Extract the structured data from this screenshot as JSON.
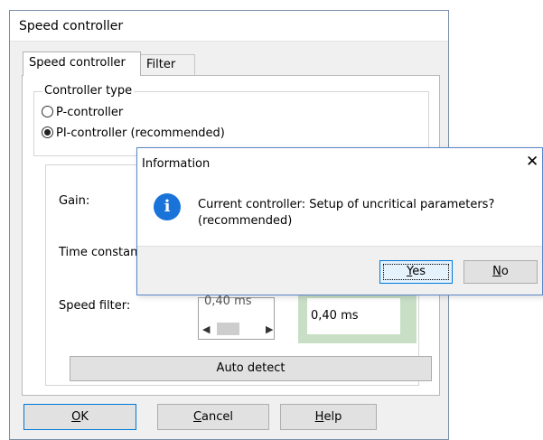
{
  "window": {
    "title": "Speed controller"
  },
  "tabs": [
    {
      "label": "Speed controller",
      "active": true
    },
    {
      "label": "Filter",
      "active": false
    }
  ],
  "controller_type": {
    "legend": "Controller type",
    "options": [
      {
        "label": "P-controller",
        "selected": false
      },
      {
        "label": "PI-controller (recommended)",
        "selected": true
      }
    ]
  },
  "params": {
    "gain_label": "Gain:",
    "time_constant_label": "Time constant:",
    "speed_filter_label": "Speed filter:",
    "speed_filter_value": "0,40 ms",
    "recommended_value": "0,40 ms",
    "auto_detect_label": "Auto detect"
  },
  "buttons": {
    "ok_underline": "O",
    "ok_rest": "K",
    "cancel_underline": "C",
    "cancel_rest": "ancel",
    "help_underline": "H",
    "help_rest": "elp"
  },
  "info_dialog": {
    "title": "Information",
    "close_glyph": "✕",
    "icon_glyph": "i",
    "message_line1": "Current controller: Setup of uncritical parameters?",
    "message_line2": "(recommended)",
    "yes_underline": "Y",
    "yes_rest": "es",
    "no_underline": "N",
    "no_rest": "o"
  },
  "colors": {
    "accent": "#0078d7",
    "info_icon": "#1a73d9",
    "recommended_bg": "#c8dfc6"
  }
}
